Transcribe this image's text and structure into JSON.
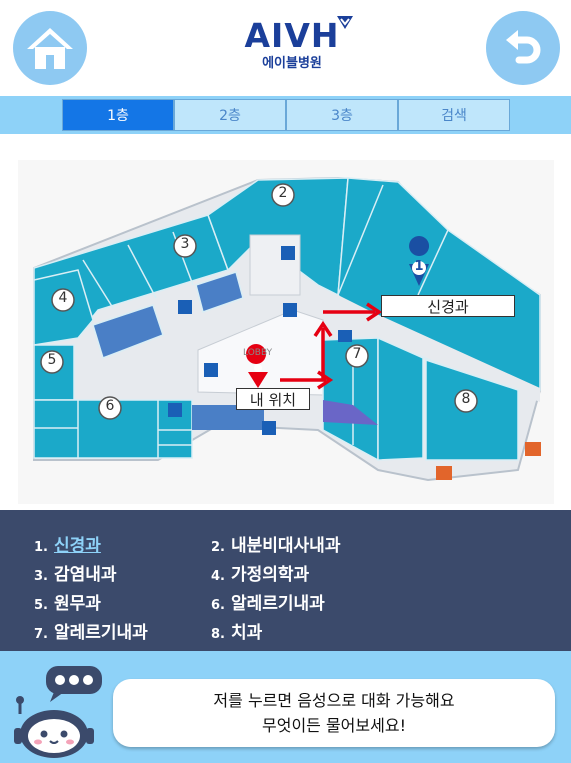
{
  "header": {
    "logo_text": "AIVH",
    "logo_subtitle": "에이블병원",
    "home_icon": "home-icon",
    "back_icon": "undo-arrow-icon"
  },
  "tabs": [
    {
      "label": "1층",
      "active": true
    },
    {
      "label": "2층",
      "active": false
    },
    {
      "label": "3층",
      "active": false
    },
    {
      "label": "검색",
      "active": false
    }
  ],
  "map": {
    "lobby_label": "LOBBY",
    "destination_label": "신경과",
    "my_location_label": "내 위치",
    "markers": [
      "1",
      "2",
      "3",
      "4",
      "5",
      "6",
      "7",
      "8"
    ]
  },
  "departments": [
    {
      "num": "1.",
      "name": "신경과",
      "selected": true
    },
    {
      "num": "2.",
      "name": "내분비대사내과",
      "selected": false
    },
    {
      "num": "3.",
      "name": "감염내과",
      "selected": false
    },
    {
      "num": "4.",
      "name": "가정의학과",
      "selected": false
    },
    {
      "num": "5.",
      "name": "원무과",
      "selected": false
    },
    {
      "num": "6.",
      "name": "알레르기내과",
      "selected": false
    },
    {
      "num": "7.",
      "name": "알레르기내과",
      "selected": false
    },
    {
      "num": "8.",
      "name": "치과",
      "selected": false
    }
  ],
  "assistant": {
    "line1": "저를 누르면 음성으로 대화 가능해요",
    "line2": "무엇이든 물어보세요!"
  },
  "colors": {
    "accent": "#1476e6",
    "tab_bar": "#8ed2f8",
    "room": "#1ba9c9",
    "panel": "#3b4a6b",
    "route": "#e60012"
  }
}
